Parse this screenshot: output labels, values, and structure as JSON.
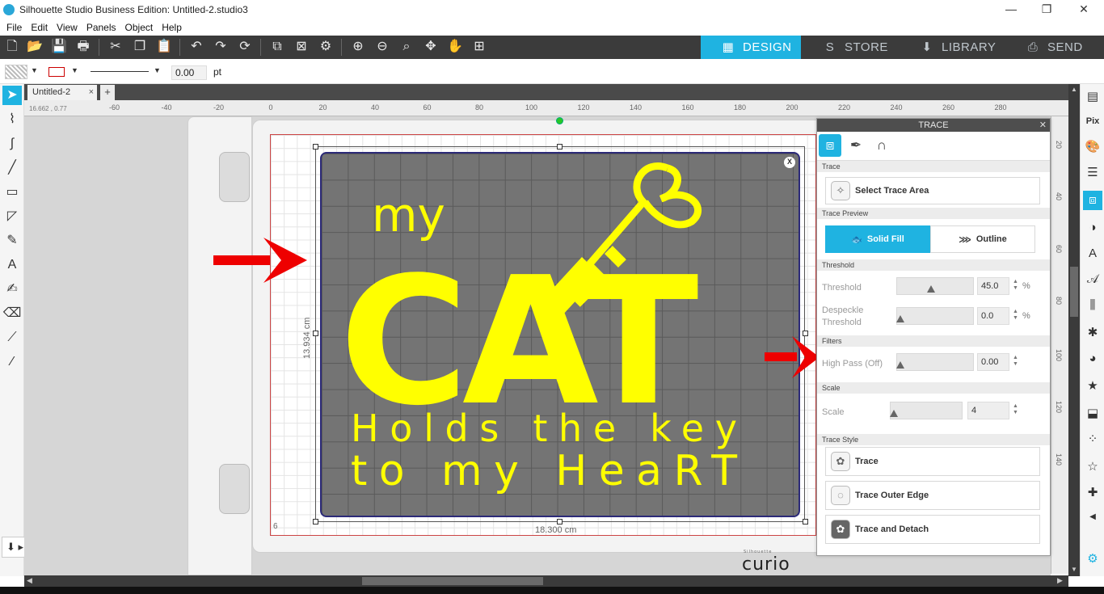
{
  "window": {
    "title": "Silhouette Studio Business Edition: Untitled-2.studio3",
    "minimize": "—",
    "restore": "❐",
    "close": "✕"
  },
  "menu": [
    "File",
    "Edit",
    "View",
    "Panels",
    "Object",
    "Help"
  ],
  "top_nav": {
    "design": "DESIGN",
    "store": "STORE",
    "library": "LIBRARY",
    "send": "SEND"
  },
  "properties": {
    "line_width": "0.00",
    "unit": "pt"
  },
  "document": {
    "tab_name": "Untitled-2",
    "tab_close": "×",
    "add_tab": "+",
    "cursor_position": "16.662 , 0.77"
  },
  "ruler": {
    "h_labels": [
      "-60",
      "-40",
      "-20",
      "0",
      "20",
      "40",
      "60",
      "80",
      "100",
      "120",
      "140",
      "160",
      "180",
      "200",
      "220",
      "240",
      "260",
      "280"
    ],
    "v_labels": [
      "20",
      "40",
      "60",
      "80",
      "100",
      "120",
      "140"
    ]
  },
  "canvas": {
    "width_label": "18.300 cm",
    "height_label": "13.934 cm",
    "mat_corner": "6",
    "brand_small": "Silhouette",
    "brand": "curio"
  },
  "design_text": {
    "line1": "my",
    "line2": "CAT",
    "line3": "Holds the key",
    "line4": "to my HeaRT"
  },
  "trace": {
    "title": "TRACE",
    "close": "✕",
    "sections": {
      "trace": "Trace",
      "preview": "Trace Preview",
      "threshold": "Threshold",
      "filters": "Filters",
      "scale": "Scale",
      "style": "Trace Style"
    },
    "select_area": "Select Trace Area",
    "solid_fill": "Solid Fill",
    "outline": "Outline",
    "threshold_label": "Threshold",
    "threshold_value": "45.0",
    "threshold_level": 0.45,
    "despeckle_label_1": "Despeckle",
    "despeckle_label_2": "Threshold",
    "despeckle_value": "0.0",
    "percent": "%",
    "high_pass_label": "High Pass (Off)",
    "high_pass_value": "0.00",
    "scale_label": "Scale",
    "scale_value": "4",
    "btn_trace": "Trace",
    "btn_outer_edge": "Trace Outer Edge",
    "btn_detach": "Trace and Detach"
  },
  "colors": {
    "accent": "#1fb3e1",
    "toolbar": "#3b3b3b",
    "design_fill": "#ffff00",
    "arrow": "#ee0000"
  }
}
